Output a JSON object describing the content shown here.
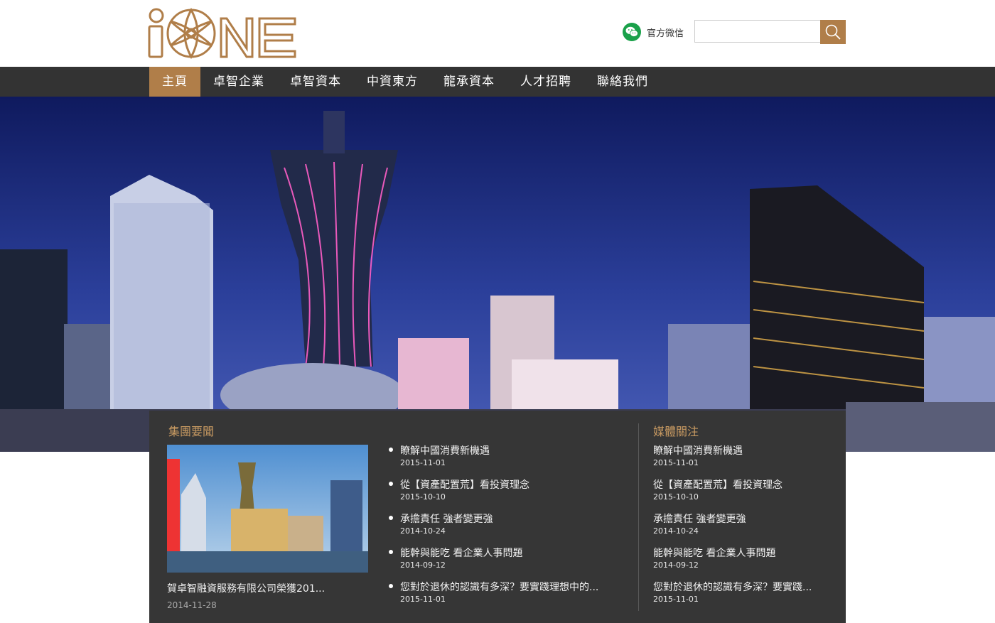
{
  "header": {
    "logo_text": "iONE",
    "wechat_label": "官方微信",
    "search_placeholder": "",
    "brand_color": "#b07e49"
  },
  "nav": {
    "items": [
      {
        "label": "主頁",
        "active": true
      },
      {
        "label": "卓智企業",
        "active": false
      },
      {
        "label": "卓智資本",
        "active": false
      },
      {
        "label": "中資東方",
        "active": false
      },
      {
        "label": "龍承資本",
        "active": false
      },
      {
        "label": "人才招聘",
        "active": false
      },
      {
        "label": "聯絡我們",
        "active": false
      }
    ]
  },
  "group_news": {
    "title": "集團要聞",
    "feature": {
      "caption": "賀卓智融資服務有限公司榮獲201...",
      "date": "2014-11-28"
    },
    "items": [
      {
        "title": "瞭解中國消費新機遇",
        "date": "2015-11-01"
      },
      {
        "title": "從【資產配置荒】看投資理念",
        "date": "2015-10-10"
      },
      {
        "title": "承擔責任 強者變更強",
        "date": "2014-10-24"
      },
      {
        "title": "能幹與能吃 看企業人事問題",
        "date": "2014-09-12"
      },
      {
        "title": "您對於退休的認識有多深？要實踐理想中的...",
        "date": "2015-11-01"
      }
    ]
  },
  "media": {
    "title": "媒體關注",
    "items": [
      {
        "title": "瞭解中國消費新機遇",
        "date": "2015-11-01"
      },
      {
        "title": "從【資產配置荒】看投資理念",
        "date": "2015-10-10"
      },
      {
        "title": "承擔責任 強者變更強",
        "date": "2014-10-24"
      },
      {
        "title": "能幹與能吃 看企業人事問題",
        "date": "2014-09-12"
      },
      {
        "title": "您對於退休的認識有多深？要實踐...",
        "date": "2015-11-01"
      }
    ]
  }
}
